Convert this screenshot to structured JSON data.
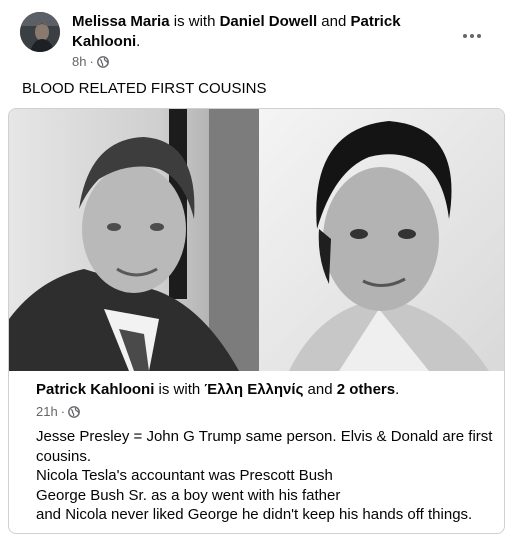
{
  "post": {
    "author": "Melissa Maria",
    "with_word": "is with",
    "tagged_1": "Daniel Dowell",
    "and_word": "and",
    "tagged_2": "Patrick Kahlooni",
    "time": "8h",
    "separator": "·",
    "privacy_icon": "globe-icon",
    "text": "BLOOD RELATED FIRST COUSINS",
    "more_icon": "more-options-icon"
  },
  "shared": {
    "author": "Patrick Kahlooni",
    "with_word": "is with",
    "tagged_1": "Έλλη Ελληνίς",
    "and_word": "and",
    "others": "2 others",
    "time": "21h",
    "separator": "·",
    "privacy_icon": "globe-icon",
    "lines": [
      "Jesse Presley = John G Trump same person. Elvis & Donald are first cousins.",
      "Nicola Tesla's accountant was Prescott Bush",
      "George Bush Sr. as a boy went with his father",
      "and Nicola never liked George he didn't keep his hands off things."
    ]
  },
  "colors": {
    "text": "#050505",
    "secondary": "#65676b",
    "border": "#ced0d4"
  }
}
